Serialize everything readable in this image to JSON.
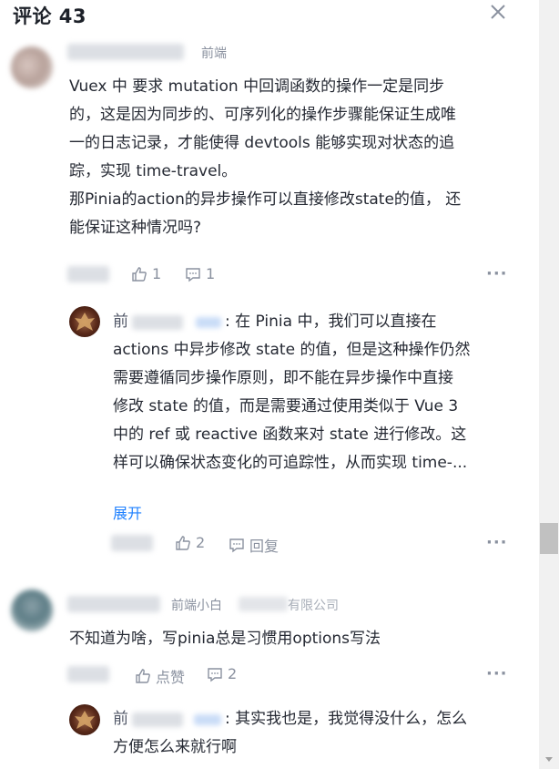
{
  "header": {
    "title": "评论 43"
  },
  "comments": [
    {
      "badge": "前端",
      "text_lines": [
        "Vuex 中 要求 mutation 中回调函数的操作一定是同步",
        "的，这是因为同步的、可序列化的操作步骤能保证生成唯",
        "一的日志记录，才能使得 devtools 能够实现对状态的追",
        "踪，实现 time-travel。",
        "那Pinia的action的异步操作可以直接修改state的值， 还",
        "能保证这种情况吗?"
      ],
      "likes": "1",
      "replies": "1",
      "more": "···",
      "reply": {
        "author_prefix": "前",
        "text_lines": [
          ": 在 Pinia 中，我们可以直接在",
          "actions 中异步修改 state 的值，但是这种操作仍然",
          "需要遵循同步操作原则，即不能在异步操作中直接",
          "修改 state 的值，而是需要通过使用类似于 Vue 3",
          "中的 ref 或 reactive 函数来对 state 进行修改。这",
          "样可以确保状态变化的可追踪性，从而实现 time-..."
        ],
        "expand": "展开",
        "likes": "2",
        "reply_label": "回复",
        "more": "···"
      }
    },
    {
      "badge": "前端小白",
      "company": "有限公司",
      "text": "不知道为啥，写pinia总是习惯用options写法",
      "like_label": "点赞",
      "replies": "2",
      "more": "···",
      "reply": {
        "author_prefix": "前",
        "text_lines": [
          ": 其实我也是，我觉得没什么，怎么",
          "方便怎么来就行啊"
        ]
      }
    }
  ]
}
